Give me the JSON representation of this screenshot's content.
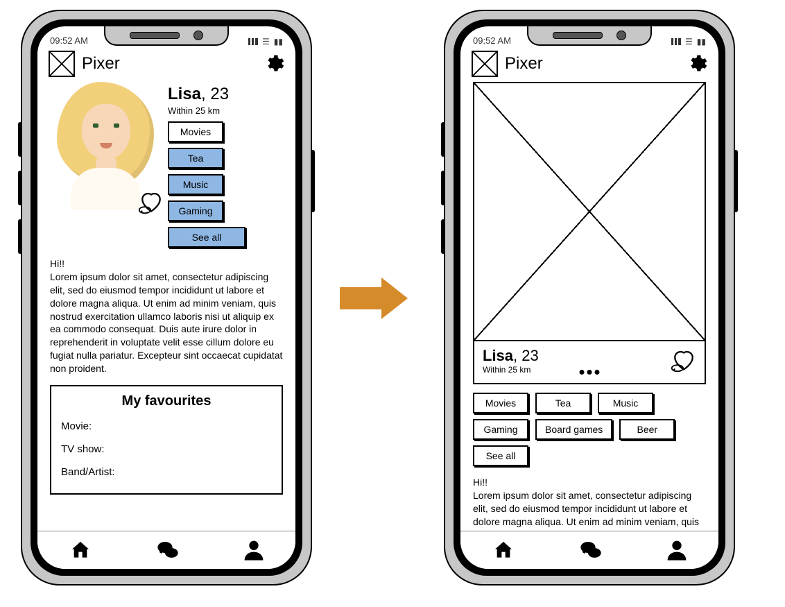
{
  "status": {
    "time": "09:52 AM"
  },
  "header": {
    "app_title": "Pixer"
  },
  "profile": {
    "name": "Lisa",
    "age": "23",
    "distance": "Within 25 km",
    "greeting": "Hi!!",
    "bio_long": "Lorem ipsum dolor sit amet, consectetur adipiscing elit, sed do eiusmod tempor incididunt ut labore et dolore magna aliqua. Ut enim ad minim veniam, quis nostrud exercitation ullamco laboris nisi ut aliquip ex ea commodo consequat. Duis aute irure dolor in reprehenderit in voluptate velit esse cillum dolore eu fugiat nulla pariatur. Excepteur sint occaecat cupidatat non proident.",
    "bio_short": "Lorem ipsum dolor sit amet, consectetur adipiscing elit, sed do eiusmod tempor incididunt ut labore et dolore magna aliqua. Ut enim ad minim veniam, quis nostrud exercitation ullamco laboris nisi ut aliquip ex"
  },
  "tags_a": {
    "0": "Movies",
    "1": "Tea",
    "2": "Music",
    "3": "Gaming",
    "see_all": "See all"
  },
  "tags_b": {
    "0": "Movies",
    "1": "Tea",
    "2": "Music",
    "3": "Gaming",
    "4": "Board games",
    "5": "Beer",
    "see_all": "See all"
  },
  "favourites": {
    "title": "My favourites",
    "rows": {
      "0": "Movie:",
      "1": "TV show:",
      "2": "Band/Artist:"
    }
  },
  "colors": {
    "tag_blue": "#8fb7e4",
    "arrow": "#d68b2b"
  }
}
